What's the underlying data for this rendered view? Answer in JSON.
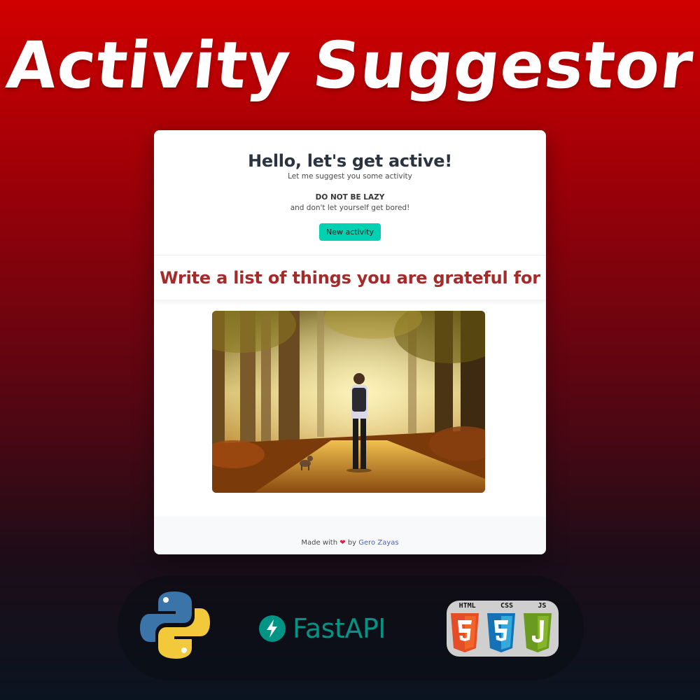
{
  "banner": {
    "title": "Activity Suggestor"
  },
  "hero": {
    "title": "Hello, let's get active!",
    "subtitle": "Let me suggest you some activity",
    "emphasis": "DO NOT BE LAZY",
    "tagline": "and don't let yourself get bored!",
    "button_label": "New activity"
  },
  "activity": {
    "text": "Write a list of things you are grateful for"
  },
  "footer": {
    "prefix": "Made with",
    "heart": "❤",
    "by": "by",
    "author": "Gero Zayas"
  },
  "tech": {
    "fastapi_label": "FastAPI",
    "web_labels": [
      "HTML",
      "CSS",
      "JS"
    ]
  },
  "colors": {
    "button": "#00d1b2",
    "activity_text": "#a52a2a",
    "link": "#485fc7",
    "fastapi": "#009485"
  }
}
